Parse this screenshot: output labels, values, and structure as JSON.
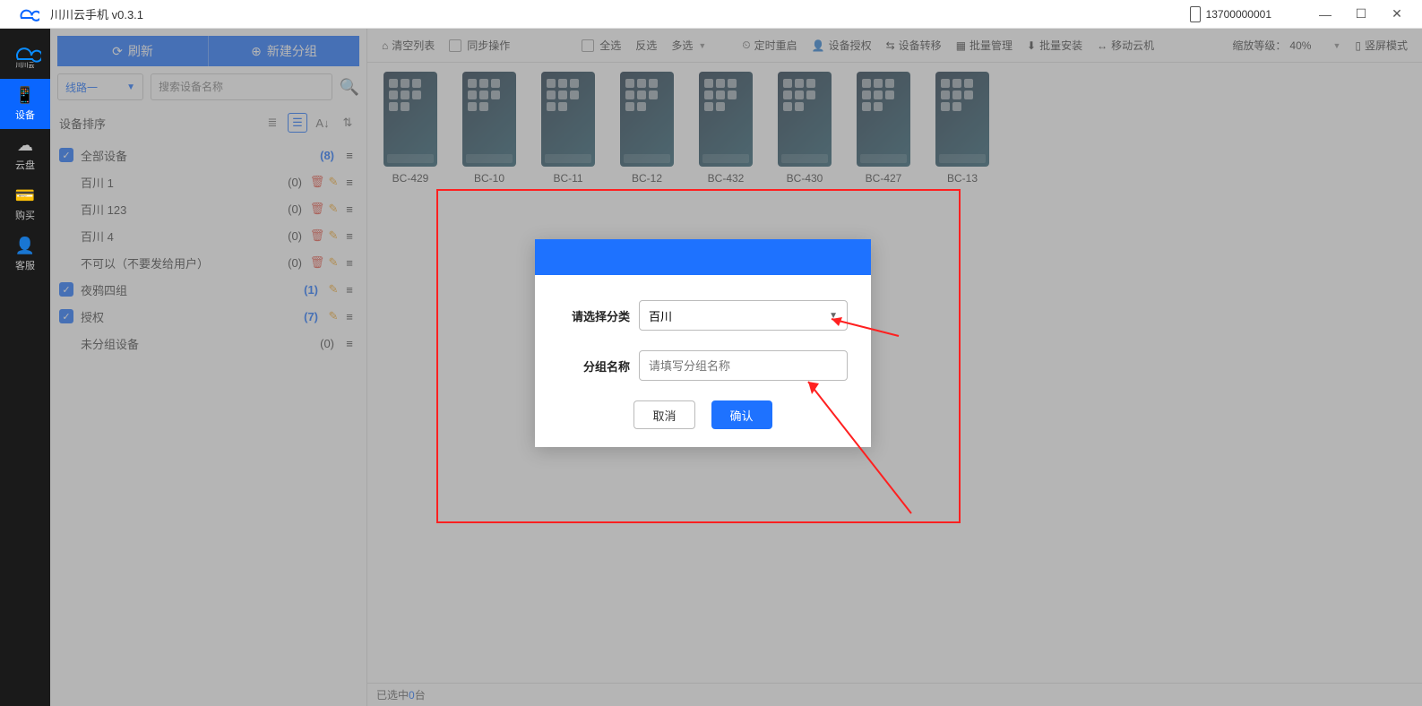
{
  "app": {
    "title": "川川云手机 v0.3.1",
    "phone": "13700000001"
  },
  "rail": {
    "items": [
      {
        "icon": "📱",
        "label": "设备",
        "active": true
      },
      {
        "icon": "☁",
        "label": "云盘",
        "active": false
      },
      {
        "icon": "💳",
        "label": "购买",
        "active": false
      },
      {
        "icon": "👤",
        "label": "客服",
        "active": false
      }
    ]
  },
  "sidebar": {
    "refresh": "刷新",
    "new_group": "新建分组",
    "line_select": "线路一",
    "search_placeholder": "搜索设备名称",
    "sort_label": "设备排序",
    "tree": [
      {
        "type": "root",
        "name": "全部设备",
        "count": "(8)",
        "countBlue": true,
        "checked": true
      },
      {
        "type": "sub",
        "name": "百川 1",
        "count": "(0)",
        "del": true,
        "edit": true
      },
      {
        "type": "sub",
        "name": "百川 123",
        "count": "(0)",
        "del": true,
        "edit": true
      },
      {
        "type": "sub",
        "name": "百川 4",
        "count": "(0)",
        "del": true,
        "edit": true
      },
      {
        "type": "sub",
        "name": "不可以（不要发给用户）",
        "count": "(0)",
        "del": true,
        "edit": true
      },
      {
        "type": "root",
        "name": "夜鸦四组",
        "count": "(1)",
        "countBlue": true,
        "checked": true,
        "edit": true
      },
      {
        "type": "root",
        "name": "授权",
        "count": "(7)",
        "countBlue": true,
        "checked": true,
        "edit": true
      },
      {
        "type": "sub",
        "name": "未分组设备",
        "count": "(0)"
      }
    ]
  },
  "toolbar": {
    "clear": "清空列表",
    "sync": "同步操作",
    "select_all": "全选",
    "invert": "反选",
    "multi": "多选",
    "timed_restart": "定时重启",
    "device_auth": "设备授权",
    "device_transfer": "设备转移",
    "batch_manage": "批量管理",
    "batch_install": "批量安装",
    "move_cloud": "移动云机",
    "zoom_label": "缩放等级：",
    "zoom_value": "40%",
    "portrait": "竖屏模式"
  },
  "devices": [
    {
      "name": "BC-429"
    },
    {
      "name": "BC-10"
    },
    {
      "name": "BC-11"
    },
    {
      "name": "BC-12"
    },
    {
      "name": "BC-432"
    },
    {
      "name": "BC-430"
    },
    {
      "name": "BC-427"
    },
    {
      "name": "BC-13"
    }
  ],
  "status": {
    "prefix": "已选中",
    "count": "0",
    "suffix": "台"
  },
  "modal": {
    "category_label": "请选择分类",
    "category_value": "百川",
    "name_label": "分组名称",
    "name_placeholder": "请填写分组名称",
    "cancel": "取消",
    "confirm": "确认"
  }
}
